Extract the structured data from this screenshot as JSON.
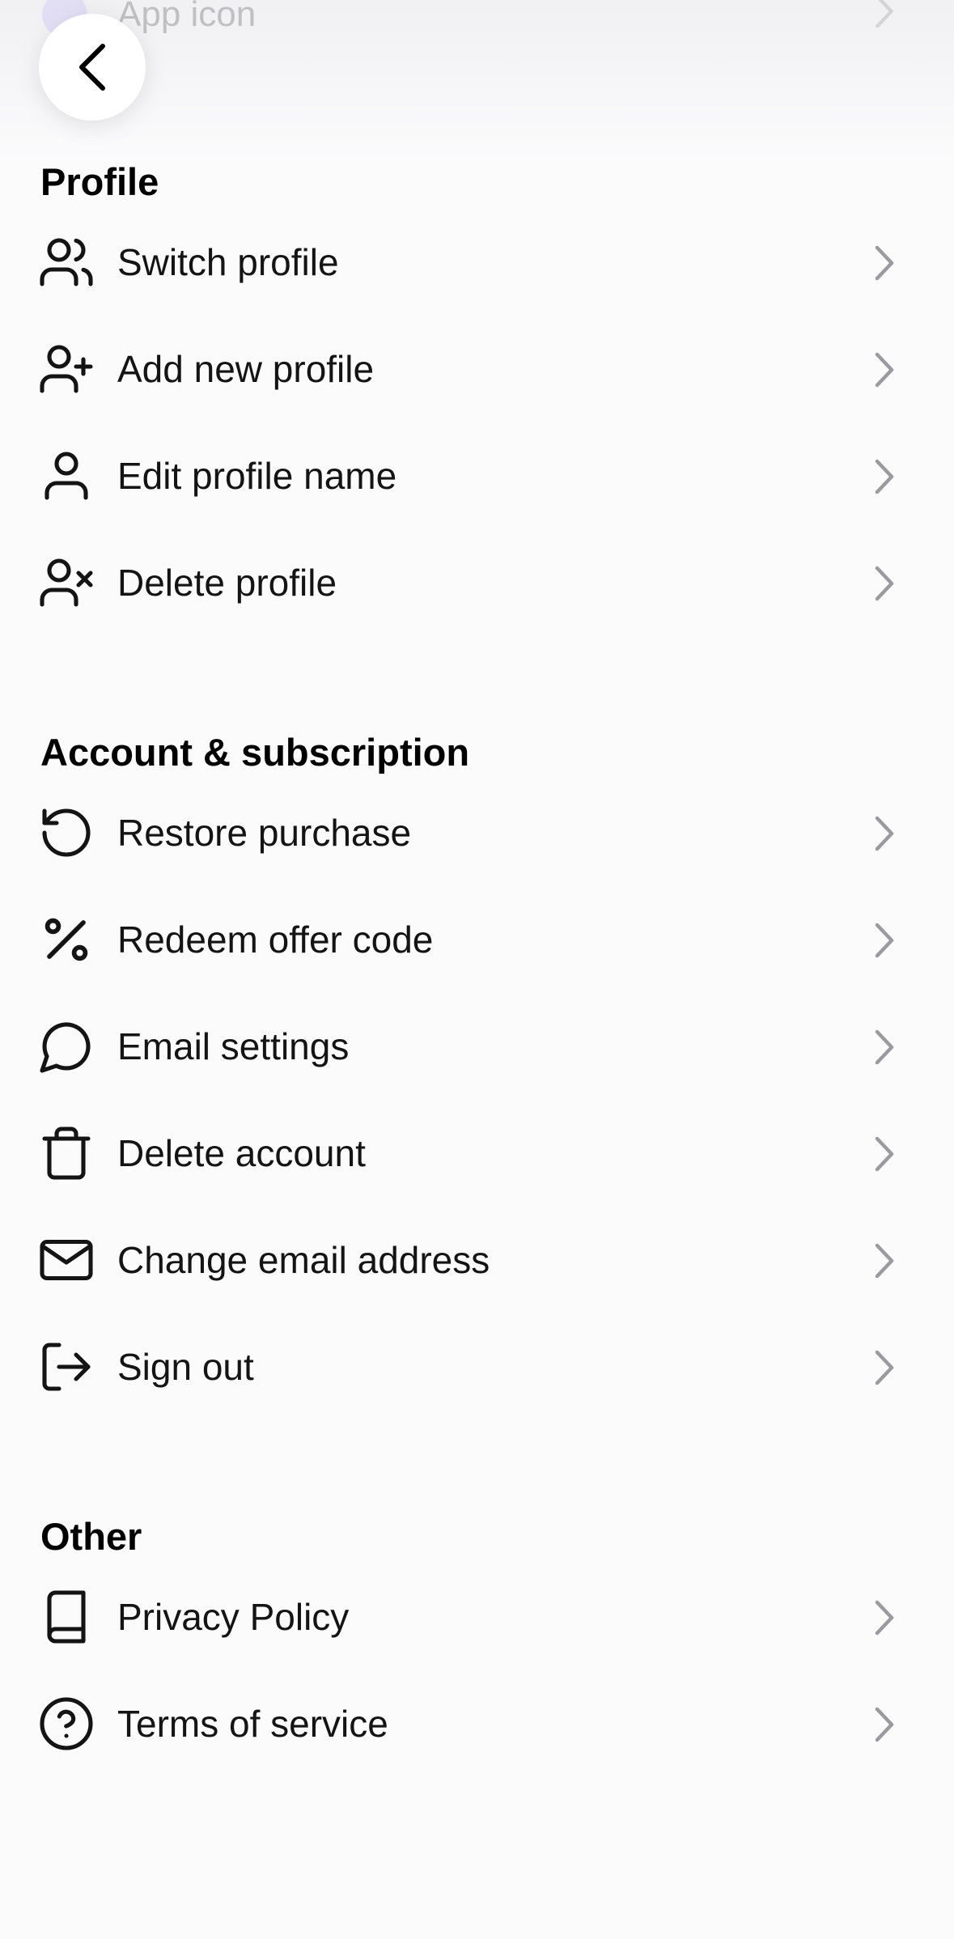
{
  "top_row": {
    "label": "App icon",
    "icon": "app-icon-dot",
    "chevron": "chevron-right-icon"
  },
  "header": {
    "back_icon": "chevron-left-icon"
  },
  "sections": [
    {
      "title": "Profile",
      "items": [
        {
          "label": "Switch profile",
          "icon": "users-icon"
        },
        {
          "label": "Add new profile",
          "icon": "user-plus-icon"
        },
        {
          "label": "Edit profile name",
          "icon": "user-icon"
        },
        {
          "label": "Delete profile",
          "icon": "user-x-icon"
        }
      ]
    },
    {
      "title": "Account & subscription",
      "items": [
        {
          "label": "Restore purchase",
          "icon": "rotate-ccw-icon"
        },
        {
          "label": "Redeem offer code",
          "icon": "percent-icon"
        },
        {
          "label": "Email settings",
          "icon": "message-circle-icon"
        },
        {
          "label": "Delete account",
          "icon": "trash-icon"
        },
        {
          "label": "Change email address",
          "icon": "mail-icon"
        },
        {
          "label": "Sign out",
          "icon": "log-out-icon"
        }
      ]
    },
    {
      "title": "Other",
      "items": [
        {
          "label": "Privacy Policy",
          "icon": "book-icon"
        },
        {
          "label": "Terms of service",
          "icon": "help-circle-icon"
        }
      ]
    }
  ],
  "colors": {
    "background": "#fbfbfc",
    "text": "#141414",
    "chevron": "#9a9a9f",
    "faded_text": "#bfbfc4",
    "faded_dot": "#d9d4f5"
  }
}
